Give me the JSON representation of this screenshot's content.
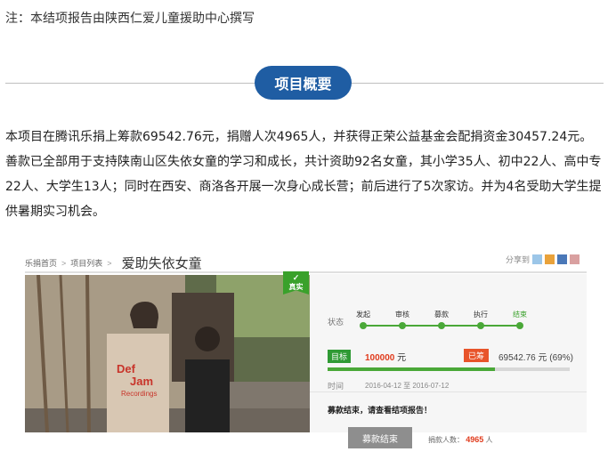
{
  "note": "注：本结项报告由陕西仁爱儿童援助中心撰写",
  "section_title": "项目概要",
  "paragraph": "本项目在腾讯乐捐上筹款69542.76元，捐赠人次4965人，并获得正荣公益基金会配捐资金30457.24元。善款已全部用于支持陕南山区失依女童的学习和成长，共计资助92名女童，其小学35人、初中22人、高中专22人、大学生13人；同时在西安、商洛各开展一次身心成长营；前后进行了5次家访。并为4名受助大学生提供暑期实习机会。",
  "screenshot": {
    "breadcrumb": [
      "乐捐首页",
      "项目列表"
    ],
    "breadcrumb_sep": ">",
    "project_title": "爱助失依女童",
    "share_label": "分享到",
    "badge": "真实",
    "state_label": "状态",
    "steps": [
      "发起",
      "审核",
      "募款",
      "执行",
      "结束"
    ],
    "goal_label": "目标",
    "goal_amount": "100000",
    "goal_unit": "元",
    "raised_label": "已筹",
    "raised_text": "69542.76 元 (69%)",
    "progress": 0.69,
    "time_label": "时间",
    "time_range": "2016-04-12 至 2016-07-12",
    "ended_note": "募款结束，请查看结项报告！",
    "end_button": "募款结束",
    "donors_label": "捐款人数：",
    "donors_count": "4965",
    "donors_unit": "人",
    "photo_shirt_text": [
      "Def",
      "Jam",
      "Recordings"
    ],
    "share_colors": [
      "#9cc6e8",
      "#e9a23b",
      "#4a78b8",
      "#d9a0a0"
    ]
  }
}
